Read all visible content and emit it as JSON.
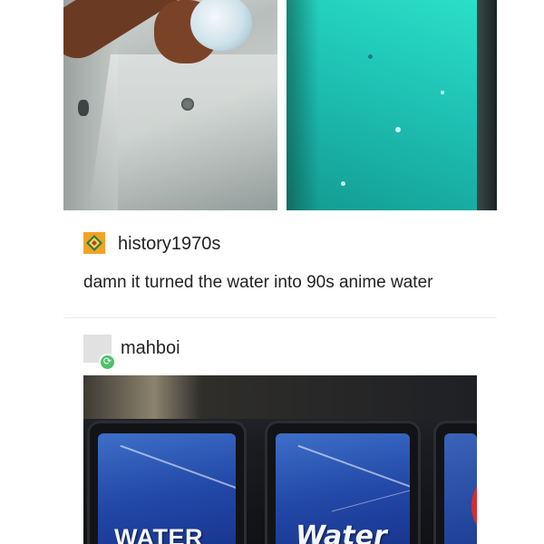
{
  "post": {
    "author": "history1970s",
    "caption": "damn it turned the water into 90s anime water",
    "photos": [
      "bath-bomb-clear-water",
      "bath-bomb-turquoise-water"
    ]
  },
  "reblog": {
    "author": "mahboi",
    "photo": {
      "buttons": [
        {
          "label": "WATER"
        },
        {
          "label": "Water"
        }
      ]
    }
  },
  "colors": {
    "turquoise_water": "#21c9b9",
    "button_blue": "#2248a8",
    "reblog_green": "#4fc068",
    "avatar_orange": "#f2a227"
  }
}
